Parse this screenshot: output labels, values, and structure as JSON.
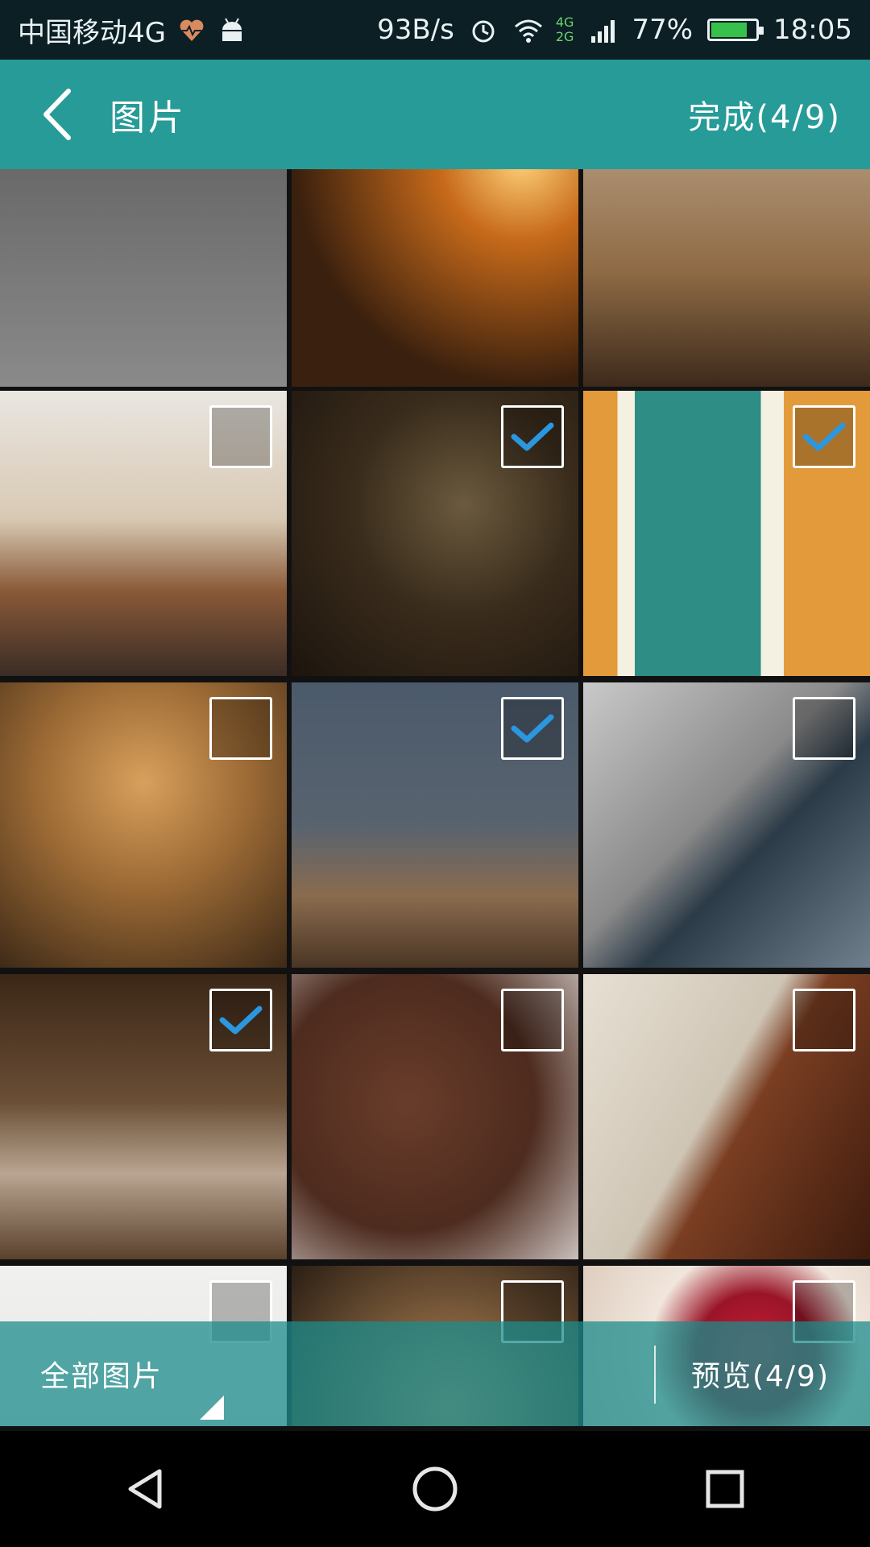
{
  "status_bar": {
    "carrier": "中国移动4G",
    "net_speed": "93B/s",
    "network_type_top": "4G",
    "network_type_bottom": "2G",
    "battery": "77%",
    "time": "18:05",
    "icons": [
      "heart-rate-icon",
      "android-icon",
      "alarm-icon",
      "wifi-icon",
      "signal-icon",
      "battery-icon"
    ]
  },
  "header": {
    "back_icon": "chevron-left-icon",
    "title": "图片",
    "done_label": "完成(4/9)"
  },
  "grid": {
    "photos": [
      {
        "scene": "grey-partial",
        "checked": null
      },
      {
        "scene": "sunset-partial",
        "checked": null
      },
      {
        "scene": "deer-partial",
        "checked": null
      },
      {
        "scene": "park-bench",
        "checked": false
      },
      {
        "scene": "dark-window",
        "checked": true
      },
      {
        "scene": "teal-door",
        "checked": true
      },
      {
        "scene": "church-stairs",
        "checked": false
      },
      {
        "scene": "goats-cliff",
        "checked": true
      },
      {
        "scene": "car-road",
        "checked": false
      },
      {
        "scene": "sandy-field",
        "checked": true
      },
      {
        "scene": "chocolate-cake",
        "checked": false
      },
      {
        "scene": "violin-music",
        "checked": false
      },
      {
        "scene": "paper-art",
        "checked": false
      },
      {
        "scene": "pottery-hands",
        "checked": false
      },
      {
        "scene": "heart-cupcake",
        "checked": false
      }
    ],
    "accent_check_color": "#2a97e0"
  },
  "bottom_bar": {
    "album_label": "全部图片",
    "preview_label": "预览(4/9)"
  },
  "nav_bar": {
    "icons": [
      "back-triangle-icon",
      "home-circle-icon",
      "recents-square-icon"
    ]
  },
  "colors": {
    "header": "#279b98",
    "status_bar": "#0b1f25",
    "bottom_bar": "#1c8c8c"
  }
}
